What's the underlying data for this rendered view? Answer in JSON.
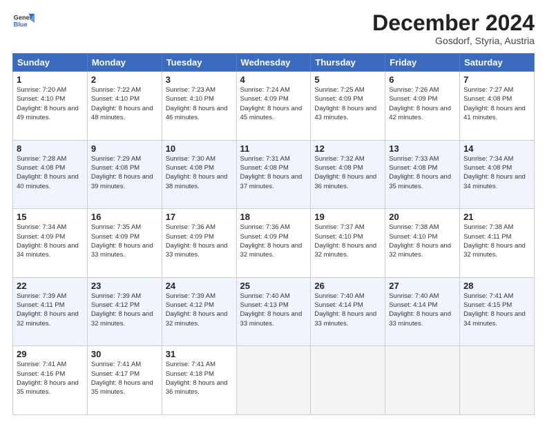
{
  "header": {
    "logo_line1": "General",
    "logo_line2": "Blue",
    "month_title": "December 2024",
    "location": "Gosdorf, Styria, Austria"
  },
  "days_of_week": [
    "Sunday",
    "Monday",
    "Tuesday",
    "Wednesday",
    "Thursday",
    "Friday",
    "Saturday"
  ],
  "weeks": [
    [
      {
        "num": "1",
        "rise": "7:20 AM",
        "set": "4:10 PM",
        "daylight": "8 hours and 49 minutes."
      },
      {
        "num": "2",
        "rise": "7:22 AM",
        "set": "4:10 PM",
        "daylight": "8 hours and 48 minutes."
      },
      {
        "num": "3",
        "rise": "7:23 AM",
        "set": "4:10 PM",
        "daylight": "8 hours and 46 minutes."
      },
      {
        "num": "4",
        "rise": "7:24 AM",
        "set": "4:09 PM",
        "daylight": "8 hours and 45 minutes."
      },
      {
        "num": "5",
        "rise": "7:25 AM",
        "set": "4:09 PM",
        "daylight": "8 hours and 43 minutes."
      },
      {
        "num": "6",
        "rise": "7:26 AM",
        "set": "4:09 PM",
        "daylight": "8 hours and 42 minutes."
      },
      {
        "num": "7",
        "rise": "7:27 AM",
        "set": "4:08 PM",
        "daylight": "8 hours and 41 minutes."
      }
    ],
    [
      {
        "num": "8",
        "rise": "7:28 AM",
        "set": "4:08 PM",
        "daylight": "8 hours and 40 minutes."
      },
      {
        "num": "9",
        "rise": "7:29 AM",
        "set": "4:08 PM",
        "daylight": "8 hours and 39 minutes."
      },
      {
        "num": "10",
        "rise": "7:30 AM",
        "set": "4:08 PM",
        "daylight": "8 hours and 38 minutes."
      },
      {
        "num": "11",
        "rise": "7:31 AM",
        "set": "4:08 PM",
        "daylight": "8 hours and 37 minutes."
      },
      {
        "num": "12",
        "rise": "7:32 AM",
        "set": "4:08 PM",
        "daylight": "8 hours and 36 minutes."
      },
      {
        "num": "13",
        "rise": "7:33 AM",
        "set": "4:08 PM",
        "daylight": "8 hours and 35 minutes."
      },
      {
        "num": "14",
        "rise": "7:34 AM",
        "set": "4:08 PM",
        "daylight": "8 hours and 34 minutes."
      }
    ],
    [
      {
        "num": "15",
        "rise": "7:34 AM",
        "set": "4:09 PM",
        "daylight": "8 hours and 34 minutes."
      },
      {
        "num": "16",
        "rise": "7:35 AM",
        "set": "4:09 PM",
        "daylight": "8 hours and 33 minutes."
      },
      {
        "num": "17",
        "rise": "7:36 AM",
        "set": "4:09 PM",
        "daylight": "8 hours and 33 minutes."
      },
      {
        "num": "18",
        "rise": "7:36 AM",
        "set": "4:09 PM",
        "daylight": "8 hours and 32 minutes."
      },
      {
        "num": "19",
        "rise": "7:37 AM",
        "set": "4:10 PM",
        "daylight": "8 hours and 32 minutes."
      },
      {
        "num": "20",
        "rise": "7:38 AM",
        "set": "4:10 PM",
        "daylight": "8 hours and 32 minutes."
      },
      {
        "num": "21",
        "rise": "7:38 AM",
        "set": "4:11 PM",
        "daylight": "8 hours and 32 minutes."
      }
    ],
    [
      {
        "num": "22",
        "rise": "7:39 AM",
        "set": "4:11 PM",
        "daylight": "8 hours and 32 minutes."
      },
      {
        "num": "23",
        "rise": "7:39 AM",
        "set": "4:12 PM",
        "daylight": "8 hours and 32 minutes."
      },
      {
        "num": "24",
        "rise": "7:39 AM",
        "set": "4:12 PM",
        "daylight": "8 hours and 32 minutes."
      },
      {
        "num": "25",
        "rise": "7:40 AM",
        "set": "4:13 PM",
        "daylight": "8 hours and 33 minutes."
      },
      {
        "num": "26",
        "rise": "7:40 AM",
        "set": "4:14 PM",
        "daylight": "8 hours and 33 minutes."
      },
      {
        "num": "27",
        "rise": "7:40 AM",
        "set": "4:14 PM",
        "daylight": "8 hours and 33 minutes."
      },
      {
        "num": "28",
        "rise": "7:41 AM",
        "set": "4:15 PM",
        "daylight": "8 hours and 34 minutes."
      }
    ],
    [
      {
        "num": "29",
        "rise": "7:41 AM",
        "set": "4:16 PM",
        "daylight": "8 hours and 35 minutes."
      },
      {
        "num": "30",
        "rise": "7:41 AM",
        "set": "4:17 PM",
        "daylight": "8 hours and 35 minutes."
      },
      {
        "num": "31",
        "rise": "7:41 AM",
        "set": "4:18 PM",
        "daylight": "8 hours and 36 minutes."
      },
      null,
      null,
      null,
      null
    ]
  ]
}
